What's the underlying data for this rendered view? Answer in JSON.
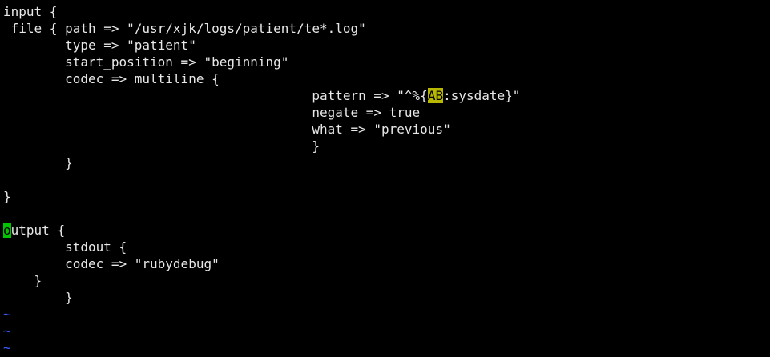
{
  "editor": {
    "lines": [
      "input {",
      " file { path => \"/usr/xjk/logs/patient/te*.log\"",
      "        type => \"patient\"",
      "        start_position => \"beginning\"",
      "        codec => multiline {",
      "                                        pattern => \"^%{",
      "                                        negate => true",
      "                                        what => \"previous\"",
      "                                        }",
      "",
      "        }",
      "",
      "}",
      "",
      "utput {",
      "        stdout {",
      "        codec => \"rubydebug\"",
      "    }",
      "        }"
    ],
    "pattern_highlight": "AB",
    "pattern_suffix": ":sysdate}\"",
    "cursor_char": "o",
    "empty_line_marker": "~",
    "colors": {
      "background": "#000000",
      "text": "#e8e8e8",
      "cursor": "#00c400",
      "search_highlight": "#b8b800",
      "tilde": "#3a5cff"
    }
  }
}
